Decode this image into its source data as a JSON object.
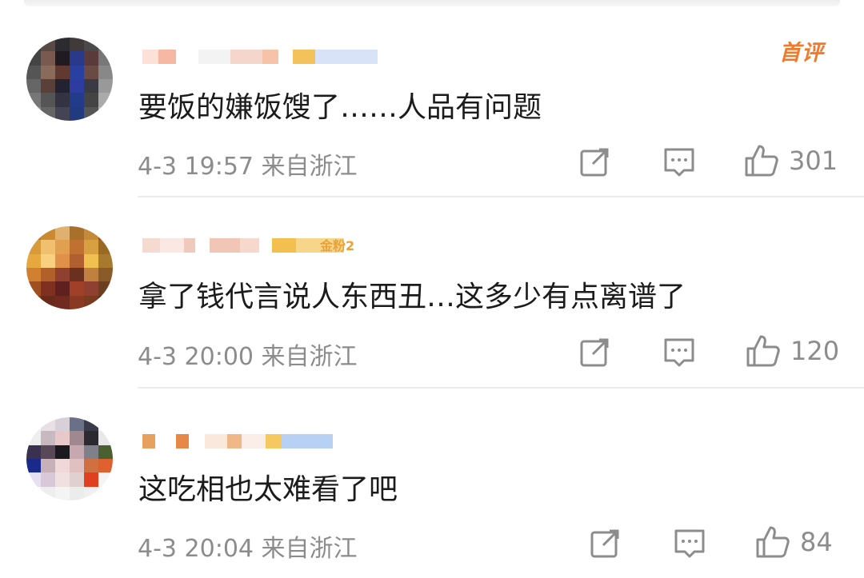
{
  "comments": [
    {
      "text": "要饭的嫌饭馊了……人品有问题",
      "time": "4-3 19:57",
      "location": "来自浙江",
      "likes": "301",
      "tag": "首评",
      "badge": ""
    },
    {
      "text": "拿了钱代言说人东西丑…这多少有点离谱了",
      "time": "4-3 20:00",
      "location": "来自浙江",
      "likes": "120",
      "tag": "",
      "badge": "金粉2"
    },
    {
      "text": "这吃相也太难看了吧",
      "time": "4-3 20:04",
      "location": "来自浙江",
      "likes": "84",
      "tag": "",
      "badge": ""
    }
  ],
  "icons": {
    "share": "share-icon",
    "reply": "comment-icon",
    "like": "thumbs-up-icon"
  },
  "colors": {
    "text": "#1b1b1b",
    "meta": "#8c8c8c",
    "first_comment_tag": "#f07a2c",
    "divider": "#ececec"
  }
}
